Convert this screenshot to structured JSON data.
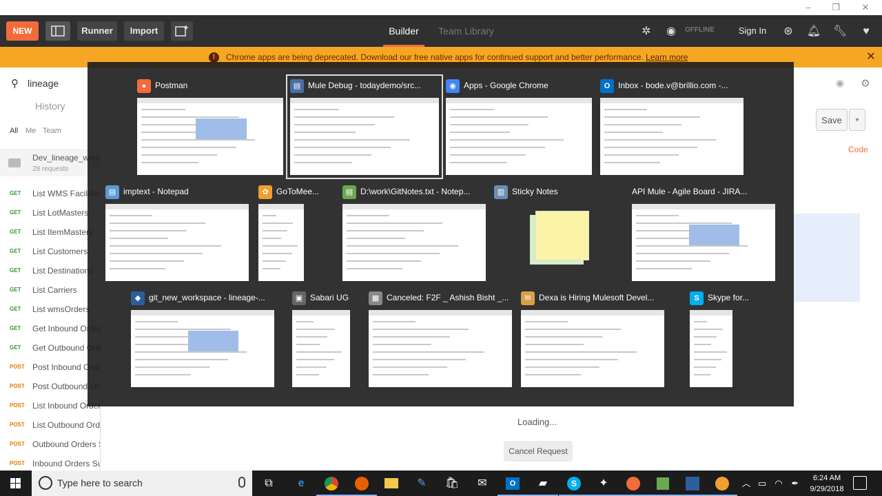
{
  "window_controls": {
    "minimize": "–",
    "restore": "❐",
    "close": "✕"
  },
  "header": {
    "new_label": "NEW",
    "runner_label": "Runner",
    "import_label": "Import",
    "builder_label": "Builder",
    "team_library_label": "Team Library",
    "offline_label": "OFFLINE",
    "sign_in_label": "Sign In",
    "accent_color": "#f26b3a"
  },
  "banner": {
    "message": "Chrome apps are being deprecated. Download our free native apps for continued support and better performance.",
    "link_text": "Learn more",
    "close": "✕",
    "color": "#f5a623"
  },
  "sidebar": {
    "search_value": "lineage",
    "tab_history": "History",
    "filters": [
      "All",
      "Me",
      "Team"
    ],
    "collection_name": "Dev_lineage_wms",
    "collection_count": "28 requests",
    "requests": [
      {
        "method": "GET",
        "name": "List WMS Facilities"
      },
      {
        "method": "GET",
        "name": "List LotMasters"
      },
      {
        "method": "GET",
        "name": "List ItemMasters"
      },
      {
        "method": "GET",
        "name": "List Customers"
      },
      {
        "method": "GET",
        "name": "List Destinations"
      },
      {
        "method": "GET",
        "name": "List Carriers"
      },
      {
        "method": "GET",
        "name": "List wmsOrders"
      },
      {
        "method": "GET",
        "name": "Get Inbound Orders"
      },
      {
        "method": "GET",
        "name": "Get Outbound Orders"
      },
      {
        "method": "POST",
        "name": "Post Inbound Orders"
      },
      {
        "method": "POST",
        "name": "Post Outbound Orders"
      },
      {
        "method": "POST",
        "name": "List Inbound Orders"
      },
      {
        "method": "POST",
        "name": "List Outbound Orders"
      },
      {
        "method": "POST",
        "name": "Outbound Orders Summary"
      },
      {
        "method": "POST",
        "name": "Inbound Orders Summary"
      }
    ]
  },
  "main": {
    "save_label": "Save",
    "code_label": "Code",
    "loading_text": "Loading...",
    "cancel_label": "Cancel Request"
  },
  "switcher": {
    "windows": [
      {
        "title": "Postman",
        "icon": "postman-icon",
        "color": "#f26b3a"
      },
      {
        "title": "Mule Debug - todaydemo/src...",
        "icon": "mule-icon",
        "color": "#4a6fa5"
      },
      {
        "title": "Apps - Google Chrome",
        "icon": "chrome-icon",
        "color": "#4285f4"
      },
      {
        "title": "Inbox - bode.v@brillio.com -...",
        "icon": "outlook-icon",
        "color": "#0072c6"
      },
      {
        "title": "imptext - Notepad",
        "icon": "notepad-icon",
        "color": "#5b9bd5"
      },
      {
        "title": "GoToMee...",
        "icon": "gotomeeting-icon",
        "color": "#f0a030"
      },
      {
        "title": "D:\\work\\GitNotes.txt - Notep...",
        "icon": "notepadpp-icon",
        "color": "#6aa84f"
      },
      {
        "title": "Sticky Notes",
        "icon": "sticky-notes-icon",
        "color": "#6d8fb3"
      },
      {
        "title": "API Mule - Agile Board - JIRA...",
        "icon": "",
        "color": "#6d8fb3"
      },
      {
        "title": "git_new_workspace - lineage-...",
        "icon": "eclipse-icon",
        "color": "#2c5e9e"
      },
      {
        "title": "Sabari UG",
        "icon": "chat-icon",
        "color": "#666666"
      },
      {
        "title": "Canceled: F2F _ Ashish Bisht _...",
        "icon": "calendar-icon",
        "color": "#888888"
      },
      {
        "title": "Dexa is Hiring Mulesoft Devel...",
        "icon": "mail-icon",
        "color": "#d9a04a"
      },
      {
        "title": "Skype for...",
        "icon": "skype-icon",
        "color": "#00aff0"
      }
    ]
  },
  "taskbar": {
    "search_placeholder": "Type here to search",
    "time": "6:24 AM",
    "date": "9/29/2018"
  }
}
